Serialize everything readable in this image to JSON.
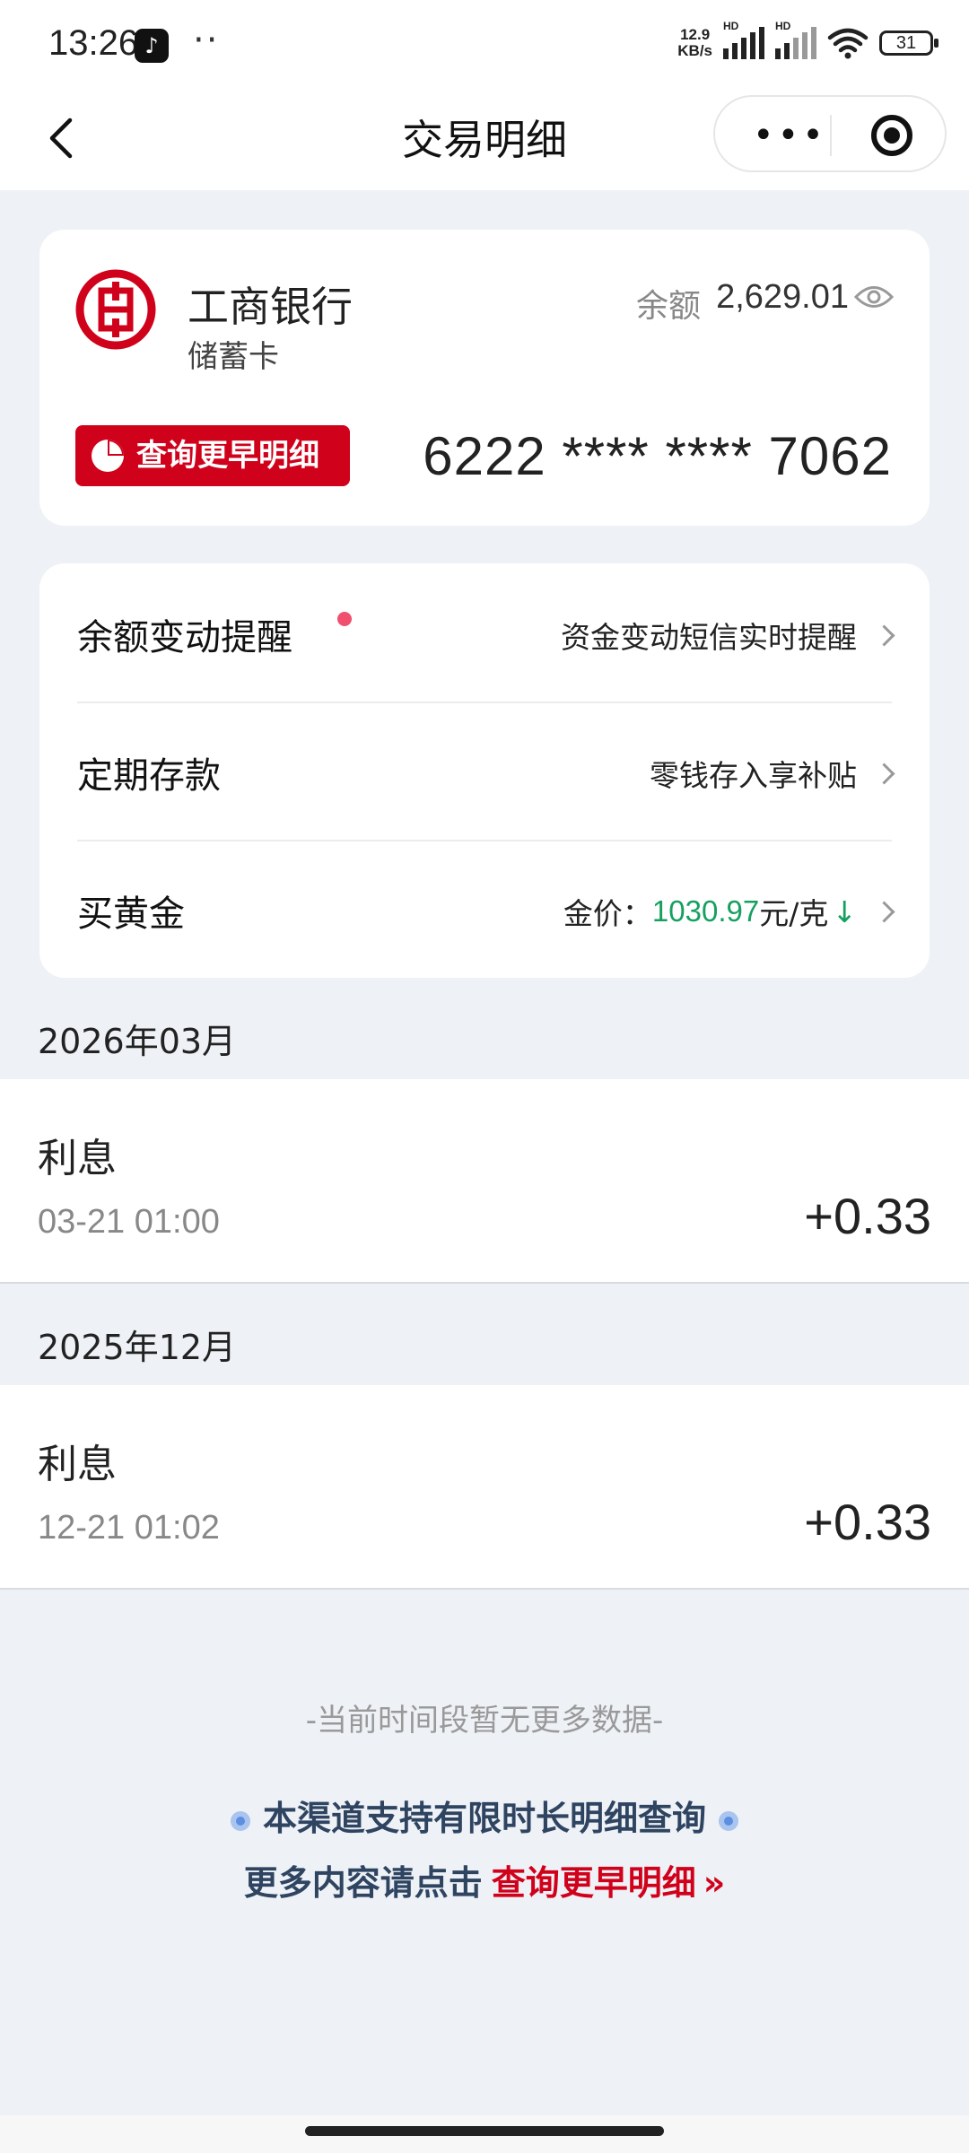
{
  "status_bar": {
    "time": "13:26",
    "app_icon": "tiktok-icon",
    "dots": "··",
    "speed_line1": "12.9",
    "speed_line2": "KB/s",
    "hd1": "HD",
    "hd2": "HD",
    "battery": "31"
  },
  "nav": {
    "title": "交易明细",
    "more_label": "•••"
  },
  "account": {
    "bank_name": "工商银行",
    "card_type": "储蓄卡",
    "balance_label": "余额",
    "balance_value": "2,629.01",
    "early_button": "查询更早明细",
    "card_number": "6222 **** **** 7062"
  },
  "services": [
    {
      "label": "余额变动提醒",
      "value": "资金变动短信实时提醒"
    },
    {
      "label": "定期存款",
      "value": "零钱存入享补贴"
    },
    {
      "label": "买黄金",
      "prefix": "金价：",
      "price": "1030.97",
      "unit": " 元/克",
      "trend": "↓"
    }
  ],
  "transactions": [
    {
      "month": "2026年03月",
      "title": "利息",
      "time": "03-21 01:00",
      "amount": "+0.33"
    },
    {
      "month": "2025年12月",
      "title": "利息",
      "time": "12-21 01:02",
      "amount": "+0.33"
    }
  ],
  "footer": {
    "no_more": "-当前时间段暂无更多数据-",
    "note1": "本渠道支持有限时长明细查询",
    "note2_prefix": "更多内容请点击",
    "note2_link": "查询更早明细",
    "note2_arrow": "»"
  },
  "colors": {
    "brand_red": "#d0021b",
    "gold_green": "#15a060",
    "page_bg": "#eef1f6"
  }
}
